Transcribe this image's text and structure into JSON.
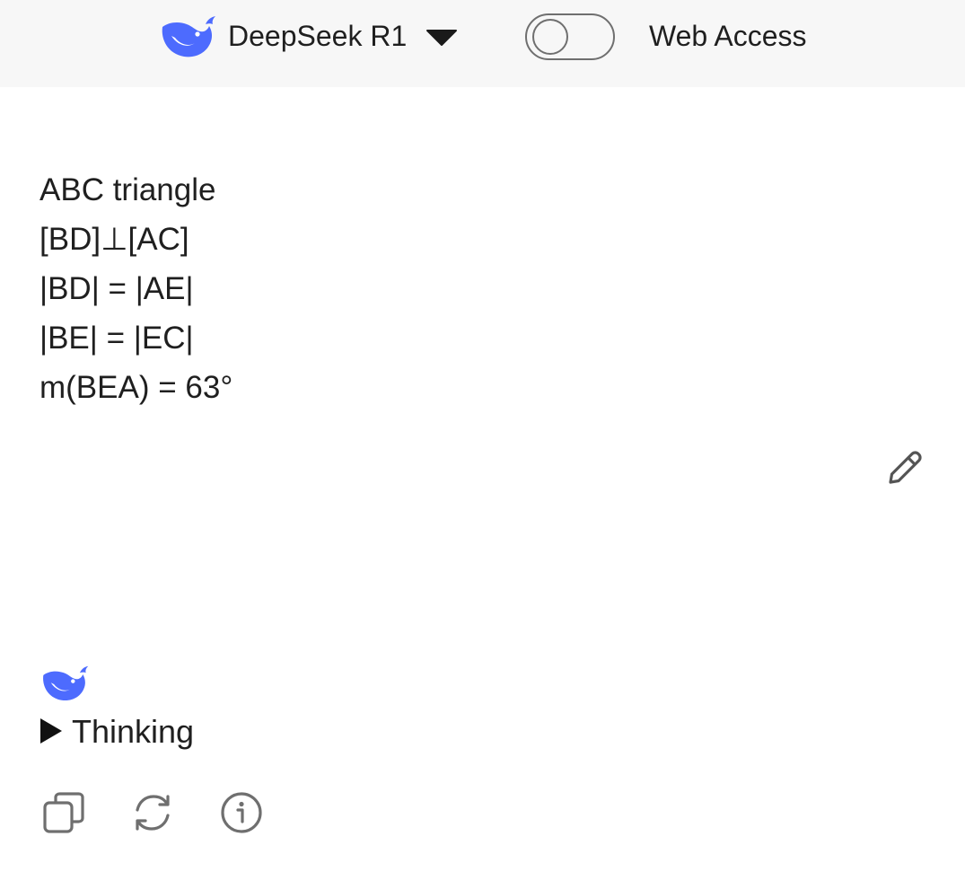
{
  "header": {
    "model_name": "DeepSeek R1",
    "web_access_label": "Web Access",
    "web_access_enabled": false,
    "logo_icon": "deepseek-whale-icon",
    "dropdown_icon": "caret-down-icon"
  },
  "message": {
    "lines": [
      "ABC triangle",
      "[BD]⊥[AC]",
      "|BD| = |AE|",
      "|BE| = |EC|",
      "m(BEA) = 63°"
    ],
    "edit_icon": "pencil-icon"
  },
  "assistant": {
    "logo_icon": "deepseek-whale-icon",
    "thinking_label": "Thinking",
    "thinking_icon": "triangle-right-icon",
    "actions": [
      {
        "icon": "copy-icon"
      },
      {
        "icon": "regenerate-icon"
      },
      {
        "icon": "info-icon"
      }
    ]
  },
  "colors": {
    "brand": "#4d6bfe",
    "header_bg": "#f7f7f7",
    "text": "#1f1f1f",
    "icon_gray": "#6f6f6f"
  }
}
